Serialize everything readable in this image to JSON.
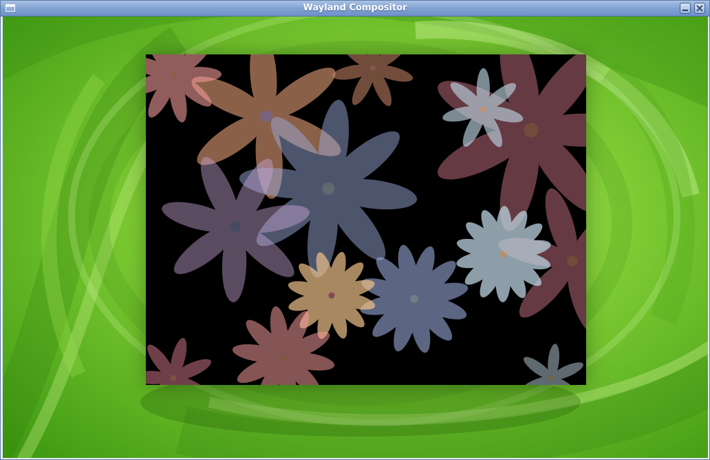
{
  "window": {
    "title": "Wayland Compositor",
    "menu_icon": "window-menu-icon",
    "minimize_icon": "minimize-icon",
    "close_icon": "close-icon"
  },
  "desktop": {
    "wallpaper": "green-leaf-swirl",
    "colors": {
      "light": "#a7e05a",
      "mid": "#5cb41c",
      "dark": "#2f7d0c"
    }
  },
  "client_window": {
    "content": "flowers-animation",
    "background": "#000000",
    "palette": [
      "#f29a9a",
      "#e8a07a",
      "#c9a6d8",
      "#9aa9d8",
      "#bcd3e0",
      "#f0c28a",
      "#b86a7a",
      "#cf8a6a"
    ]
  }
}
